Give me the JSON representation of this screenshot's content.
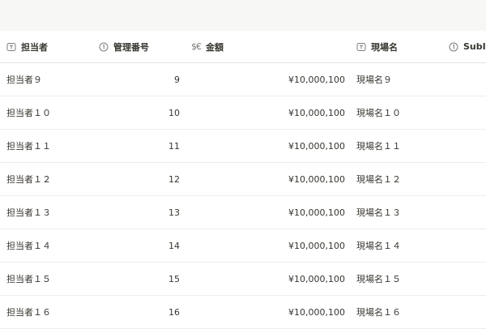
{
  "table": {
    "columns": [
      {
        "label": "担当者",
        "icon": "text-property-icon"
      },
      {
        "label": "管理番号",
        "icon": "number-property-icon"
      },
      {
        "label": "金額",
        "icon": "currency-property-icon",
        "icon_text": "$€"
      },
      {
        "label": "現場名",
        "icon": "text-property-icon"
      },
      {
        "label": "SubID",
        "icon": "number-property-icon"
      }
    ],
    "rows": [
      {
        "person": "担当者９",
        "number": "9",
        "amount": "¥10,000,100",
        "site": "現場名９"
      },
      {
        "person": "担当者１０",
        "number": "10",
        "amount": "¥10,000,100",
        "site": "現場名１０"
      },
      {
        "person": "担当者１１",
        "number": "11",
        "amount": "¥10,000,100",
        "site": "現場名１１"
      },
      {
        "person": "担当者１２",
        "number": "12",
        "amount": "¥10,000,100",
        "site": "現場名１２"
      },
      {
        "person": "担当者１３",
        "number": "13",
        "amount": "¥10,000,100",
        "site": "現場名１３"
      },
      {
        "person": "担当者１４",
        "number": "14",
        "amount": "¥10,000,100",
        "site": "現場名１４"
      },
      {
        "person": "担当者１５",
        "number": "15",
        "amount": "¥10,000,100",
        "site": "現場名１５"
      },
      {
        "person": "担当者１６",
        "number": "16",
        "amount": "¥10,000,100",
        "site": "現場名１６"
      }
    ]
  }
}
